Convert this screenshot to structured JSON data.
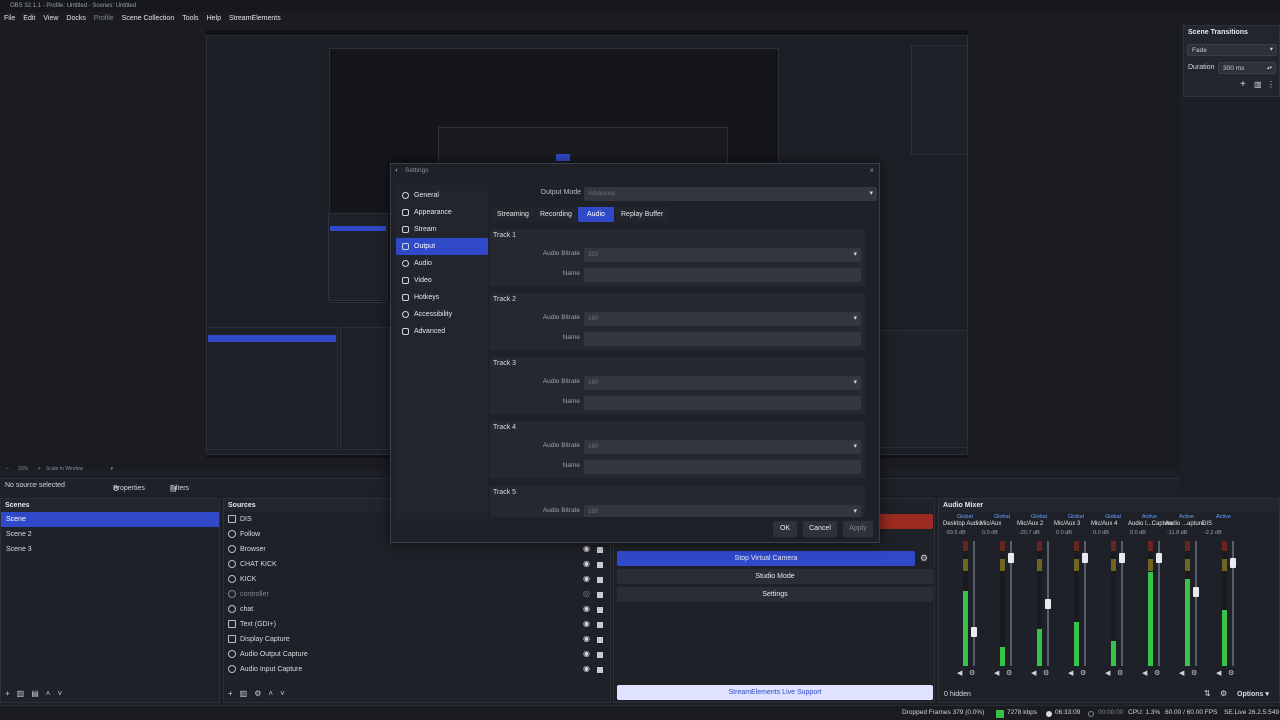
{
  "window": {
    "title": "OBS 32.1.1 - Profile: Untitled - Scenes: Untitled"
  },
  "menu": [
    "File",
    "Edit",
    "View",
    "Docks",
    "Profile",
    "Scene Collection",
    "Tools",
    "Help",
    "StreamElements"
  ],
  "scene_transitions": {
    "title": "Scene Transitions",
    "transition": "Fade",
    "duration_label": "Duration",
    "duration_value": "300 ms"
  },
  "preview_zoom": {
    "zoom": "33%",
    "mode": "Scale to Window"
  },
  "propbar": {
    "no_source": "No source selected",
    "properties": "Properties",
    "filters": "Filters"
  },
  "scenes": {
    "title": "Scenes",
    "items": [
      "Scene",
      "Scene 2",
      "Scene 3"
    ]
  },
  "sources": {
    "title": "Sources",
    "items": [
      "DIS",
      "Follow",
      "Browser",
      "CHAT KICK",
      "KICK",
      "controller",
      "chat",
      "Text (GDI+)",
      "Display Capture",
      "Audio Output Capture",
      "Audio Input Capture"
    ]
  },
  "controls": {
    "stop_virtual_camera": "Stop Virtual Camera",
    "studio_mode": "Studio Mode",
    "settings": "Settings",
    "se_support": "StreamElements Live Support"
  },
  "mixer": {
    "title": "Audio Mixer",
    "hidden": "0 hidden",
    "options": "Options",
    "channels": [
      {
        "top": "Global",
        "name": "Desktop Audio",
        "db": "-59.5 dB"
      },
      {
        "top": "Global",
        "name": "Mic/Aux",
        "db": "0.0 dB"
      },
      {
        "top": "Global",
        "name": "Mic/Aux 2",
        "db": "-20.7 dB"
      },
      {
        "top": "Global",
        "name": "Mic/Aux 3",
        "db": "0.0 dB"
      },
      {
        "top": "Global",
        "name": "Mic/Aux 4",
        "db": "0.0 dB"
      },
      {
        "top": "Active",
        "name": "Audio I...Capture",
        "db": "0.0 dB"
      },
      {
        "top": "Active",
        "name": "Audio ...apture",
        "db": "-11.8 dB"
      },
      {
        "top": "Active",
        "name": "DIS",
        "db": "-2.2 dB"
      }
    ]
  },
  "status": {
    "dropped": "Dropped Frames 379 (0.0%)",
    "kbps": "7278 kbps",
    "live_time": "06:33:09",
    "rec_time": "00:00:00",
    "cpu": "CPU: 1.3%",
    "fps": "60.00 / 60.00 FPS",
    "se": "SE.Live 26.2.5.549"
  },
  "settings_dialog": {
    "title": "Settings",
    "nav": [
      "General",
      "Appearance",
      "Stream",
      "Output",
      "Audio",
      "Video",
      "Hotkeys",
      "Accessibility",
      "Advanced"
    ],
    "output_mode_label": "Output Mode",
    "output_mode_value": "Advanced",
    "tabs": [
      "Streaming",
      "Recording",
      "Audio",
      "Replay Buffer"
    ],
    "tracks": [
      {
        "title": "Track 1",
        "bitrate": "320"
      },
      {
        "title": "Track 2",
        "bitrate": "160"
      },
      {
        "title": "Track 3",
        "bitrate": "160"
      },
      {
        "title": "Track 4",
        "bitrate": "160"
      },
      {
        "title": "Track 5",
        "bitrate": "160"
      }
    ],
    "bitrate_label": "Audio Bitrate",
    "name_label": "Name",
    "ok": "OK",
    "cancel": "Cancel",
    "apply": "Apply"
  }
}
